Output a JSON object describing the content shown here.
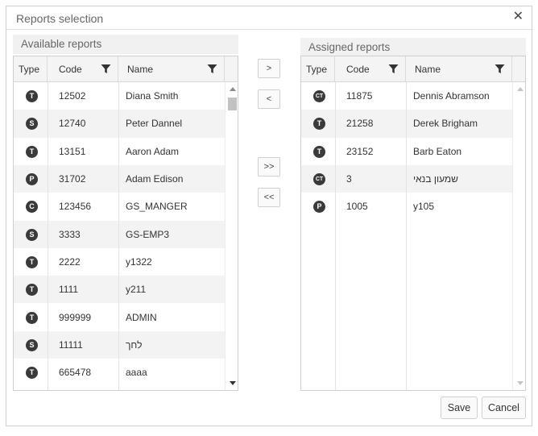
{
  "dialog": {
    "title": "Reports selection",
    "close_glyph": "✕"
  },
  "available": {
    "title": "Available reports",
    "headers": {
      "type": "Type",
      "code": "Code",
      "name": "Name"
    },
    "rows": [
      {
        "type": "T",
        "code": "12502",
        "name": "Diana Smith"
      },
      {
        "type": "S",
        "code": "12740",
        "name": "Peter Dannel"
      },
      {
        "type": "T",
        "code": "13151",
        "name": "Aaron Adam"
      },
      {
        "type": "P",
        "code": "31702",
        "name": "Adam Edison"
      },
      {
        "type": "C",
        "code": "123456",
        "name": "GS_MANGER"
      },
      {
        "type": "S",
        "code": "3333",
        "name": "GS-EMP3"
      },
      {
        "type": "T",
        "code": "2222",
        "name": "y1322"
      },
      {
        "type": "T",
        "code": "1111",
        "name": "y211"
      },
      {
        "type": "T",
        "code": "999999",
        "name": "ADMIN"
      },
      {
        "type": "S",
        "code": "11111",
        "name": "לחך"
      },
      {
        "type": "T",
        "code": "665478",
        "name": "aaaa"
      }
    ]
  },
  "assigned": {
    "title": "Assigned reports",
    "headers": {
      "type": "Type",
      "code": "Code",
      "name": "Name"
    },
    "rows": [
      {
        "type": "CT",
        "code": "11875",
        "name": "Dennis Abramson"
      },
      {
        "type": "T",
        "code": "21258",
        "name": "Derek Brigham"
      },
      {
        "type": "T",
        "code": "23152",
        "name": "Barb Eaton"
      },
      {
        "type": "CT",
        "code": "3",
        "name": "שמעון בנאי"
      },
      {
        "type": "P",
        "code": "1005",
        "name": "y105"
      }
    ]
  },
  "transfer": {
    "move_right": ">",
    "move_left": "<",
    "move_all_right": ">>",
    "move_all_left": "<<"
  },
  "footer": {
    "save": "Save",
    "cancel": "Cancel"
  },
  "icons": {
    "filter": "filter-icon",
    "close": "close-icon",
    "type_badge": "type-badge-icon"
  },
  "colors": {
    "badge": "#3a3a3a",
    "alt_row": "#f3f3f3",
    "header_bg": "#f4f4f4"
  }
}
